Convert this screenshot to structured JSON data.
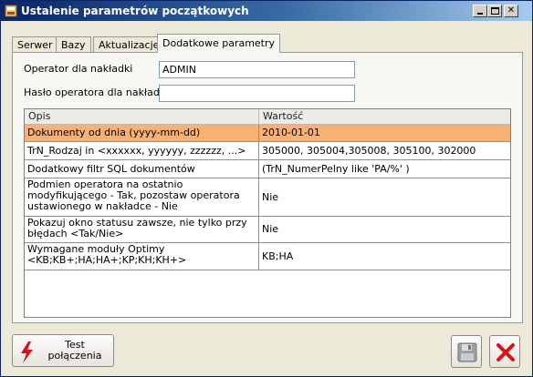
{
  "window": {
    "title": "Ustalenie parametrów początkowych"
  },
  "tabs": [
    {
      "label": "Serwer",
      "active": false
    },
    {
      "label": "Bazy",
      "active": false
    },
    {
      "label": "Aktualizacje",
      "active": false
    },
    {
      "label": "Dodatkowe parametry",
      "active": true
    }
  ],
  "form": {
    "operator_label": "Operator dla nakładki",
    "operator_value": "ADMIN",
    "password_label": "Hasło operatora dla nakładki",
    "password_value": ""
  },
  "grid": {
    "headers": [
      "Opis",
      "Wartość"
    ],
    "rows": [
      {
        "opis": "Dokumenty od dnia (yyyy-mm-dd)",
        "wartosc": "2010-01-01",
        "selected": true
      },
      {
        "opis": "TrN_Rodzaj in <xxxxxx, yyyyyy, zzzzzz, ...>",
        "wartosc": "305000, 305004,305008, 305100, 302000",
        "selected": false
      },
      {
        "opis": "Dodatkowy filtr SQL dokumentów",
        "wartosc": "(TrN_NumerPelny like 'PA/%' )",
        "selected": false
      },
      {
        "opis": "Podmien operatora na ostatnio modyfikującego - Tak, pozostaw operatora ustawionego w nakładce - Nie",
        "wartosc": "Nie",
        "selected": false
      },
      {
        "opis": "Pokazuj okno statusu zawsze, nie tylko przy błędach <Tak/Nie>",
        "wartosc": "Nie",
        "selected": false
      },
      {
        "opis": "Wymagane moduły Optimy <KB;KB+;HA;HA+;KP;KH;KH+>",
        "wartosc": "KB;HA",
        "selected": false
      }
    ]
  },
  "buttons": {
    "test_line1": "Test",
    "test_line2": "połączenia",
    "save_icon": "floppy-disk-icon",
    "cancel_icon": "red-x-icon"
  },
  "colors": {
    "selected_row": "#f8b075",
    "title_bar": "#0a246a"
  }
}
